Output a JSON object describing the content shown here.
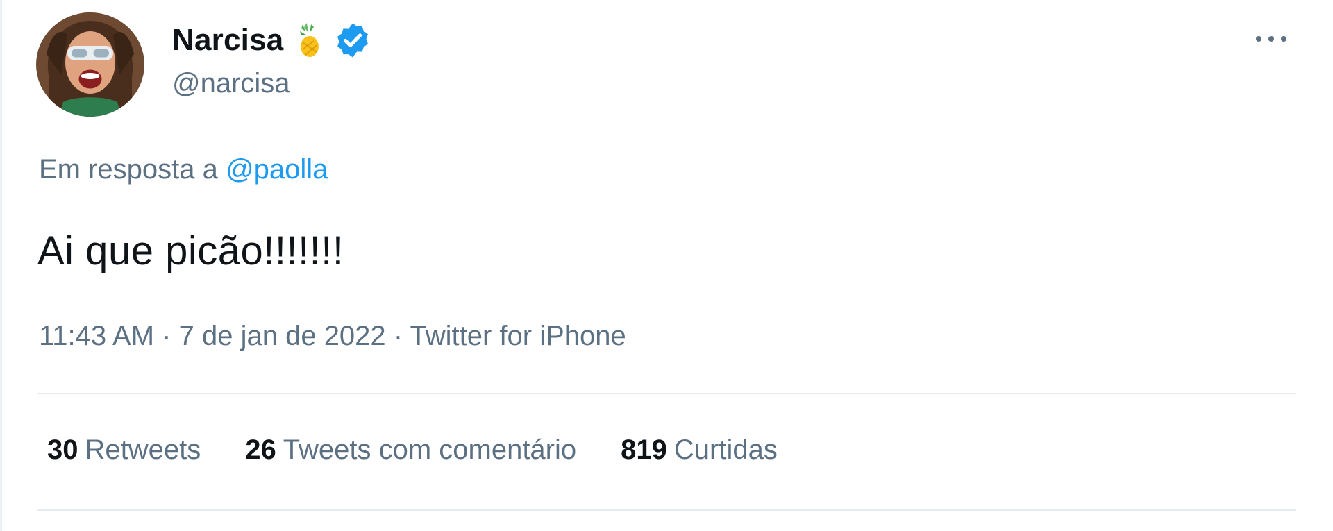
{
  "author": {
    "display_name": "Narcisa",
    "handle": "@narcisa",
    "verified": true,
    "name_emoji": "pineapple-icon"
  },
  "reply": {
    "prefix": "Em resposta a",
    "target": "@paolla"
  },
  "tweet": {
    "text": "Ai que picão!!!!!!!",
    "time": "11:43 AM",
    "separator": "·",
    "date": "7 de jan de 2022",
    "source": "Twitter for iPhone"
  },
  "stats": [
    {
      "count": "30",
      "label": "Retweets"
    },
    {
      "count": "26",
      "label": "Tweets com comentário"
    },
    {
      "count": "819",
      "label": "Curtidas"
    }
  ],
  "colors": {
    "link": "#1d9bf0",
    "secondary_text": "#5b7083",
    "primary_text": "#0f1419",
    "divider": "#e6ecf0",
    "verified": "#1d9bf0"
  }
}
